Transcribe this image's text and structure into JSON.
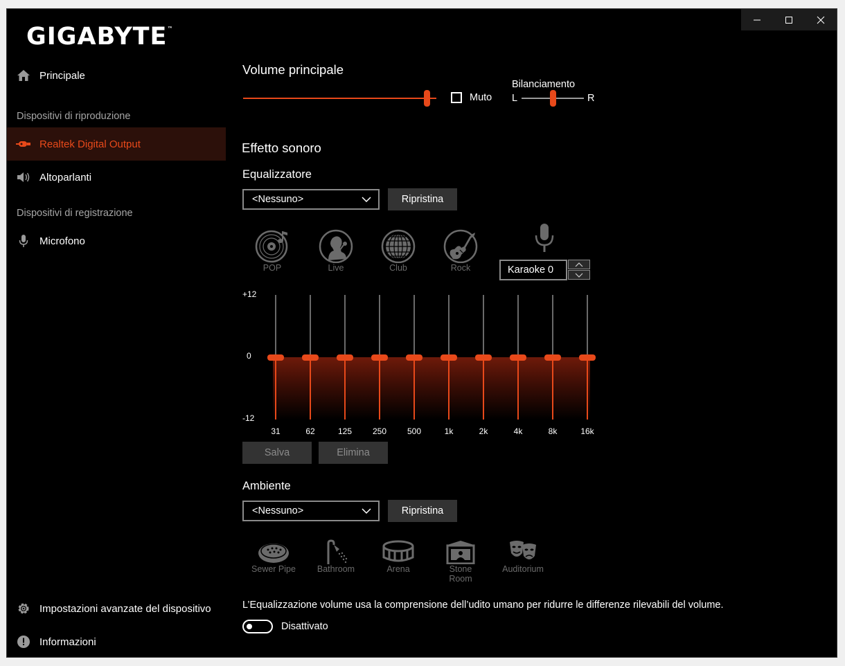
{
  "brand": {
    "logo_text": "GIGABYTE",
    "trademark": "™"
  },
  "colors": {
    "accent": "#e8491a",
    "background": "#000000",
    "disabled": "#6b6b6b"
  },
  "window_controls": {
    "minimize": "minimize-icon",
    "maximize": "maximize-icon",
    "close": "close-icon"
  },
  "sidebar": {
    "home": {
      "label": "Principale",
      "icon": "home-icon"
    },
    "playback_header": "Dispositivi di riproduzione",
    "playback_items": [
      {
        "label": "Realtek Digital Output",
        "icon": "digital-output-icon",
        "active": true
      },
      {
        "label": "Altoparlanti",
        "icon": "speaker-icon",
        "active": false
      }
    ],
    "recording_header": "Dispositivi di registrazione",
    "recording_items": [
      {
        "label": "Microfono",
        "icon": "microphone-icon"
      }
    ],
    "advanced_settings": {
      "label": "Impostazioni avanzate del dispositivo",
      "icon": "gear-icon"
    },
    "info": {
      "label": "Informazioni",
      "icon": "info-icon"
    }
  },
  "volume": {
    "title": "Volume principale",
    "level_fraction": 0.95,
    "mute_label": "Muto",
    "mute_checked": false,
    "balance_label": "Bilanciamento",
    "balance_left": "L",
    "balance_right": "R",
    "balance_fraction": 0.5
  },
  "sound_effect": {
    "title": "Effetto sonoro",
    "equalizer_label": "Equalizzatore",
    "equalizer_selected": "<Nessuno>",
    "reset_label": "Ripristina",
    "presets": [
      {
        "label": "POP",
        "icon": "vinyl-record-icon"
      },
      {
        "label": "Live",
        "icon": "singer-icon"
      },
      {
        "label": "Club",
        "icon": "disco-ball-icon"
      },
      {
        "label": "Rock",
        "icon": "electric-guitar-icon"
      }
    ],
    "karaoke": {
      "icon": "microphone-icon",
      "value": "Karaoke 0"
    },
    "eq": {
      "scale_top": "+12",
      "scale_mid": "0",
      "scale_bottom": "-12",
      "bands": [
        {
          "freq": "31",
          "gain": 0
        },
        {
          "freq": "62",
          "gain": 0
        },
        {
          "freq": "125",
          "gain": 0
        },
        {
          "freq": "250",
          "gain": 0
        },
        {
          "freq": "500",
          "gain": 0
        },
        {
          "freq": "1k",
          "gain": 0
        },
        {
          "freq": "2k",
          "gain": 0
        },
        {
          "freq": "4k",
          "gain": 0
        },
        {
          "freq": "8k",
          "gain": 0
        },
        {
          "freq": "16k",
          "gain": 0
        }
      ]
    },
    "save_label": "Salva",
    "delete_label": "Elimina",
    "ambience_label": "Ambiente",
    "ambience_selected": "<Nessuno>",
    "ambience_reset_label": "Ripristina",
    "environments": [
      {
        "label": "Sewer Pipe",
        "icon": "sewer-pipe-icon"
      },
      {
        "label": "Bathroom",
        "icon": "shower-icon"
      },
      {
        "label": "Arena",
        "icon": "arena-icon"
      },
      {
        "label": "Stone Room",
        "icon": "stone-room-icon"
      },
      {
        "label": "Auditorium",
        "icon": "theater-masks-icon"
      }
    ]
  },
  "loudness": {
    "description": "L’Equalizzazione volume usa la comprensione dell’udito umano per ridurre le differenze rilevabili del volume.",
    "toggle_state": "Disattivato",
    "enabled": false
  }
}
